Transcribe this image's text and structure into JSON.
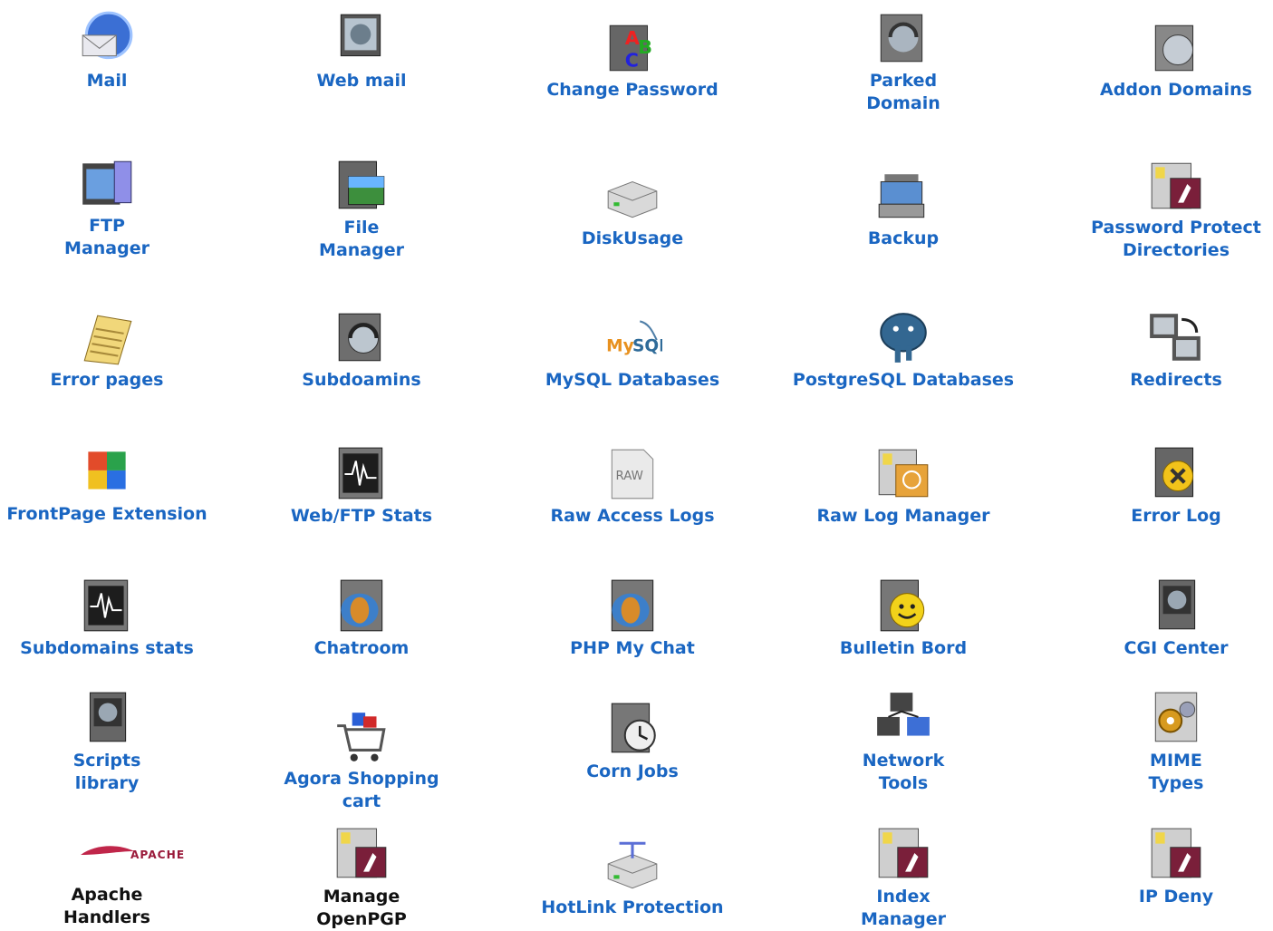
{
  "panel": {
    "items": [
      {
        "label": "Mail",
        "icon": "mail-icon",
        "link": true
      },
      {
        "label": "Web mail",
        "icon": "webmail-icon",
        "link": true
      },
      {
        "label": "Change Password",
        "icon": "change-password-icon",
        "link": true
      },
      {
        "label": "Parked\nDomain",
        "icon": "parked-domain-icon",
        "link": true
      },
      {
        "label": "Addon Domains",
        "icon": "addon-domains-icon",
        "link": true
      },
      {
        "label": "FTP\nManager",
        "icon": "ftp-manager-icon",
        "link": true
      },
      {
        "label": "File\nManager",
        "icon": "file-manager-icon",
        "link": true
      },
      {
        "label": "DiskUsage",
        "icon": "disk-usage-icon",
        "link": true
      },
      {
        "label": "Backup",
        "icon": "backup-icon",
        "link": true
      },
      {
        "label": "Password Protect\nDirectories",
        "icon": "password-protect-icon",
        "link": true
      },
      {
        "label": "Error pages",
        "icon": "error-pages-icon",
        "link": true
      },
      {
        "label": "Subdoamins",
        "icon": "subdomains-icon",
        "link": true
      },
      {
        "label": "MySQL Databases",
        "icon": "mysql-icon",
        "link": true
      },
      {
        "label": "PostgreSQL Databases",
        "icon": "postgresql-icon",
        "link": true
      },
      {
        "label": "Redirects",
        "icon": "redirects-icon",
        "link": true
      },
      {
        "label": "FrontPage Extension",
        "icon": "frontpage-icon",
        "link": true
      },
      {
        "label": "Web/FTP    Stats",
        "icon": "web-ftp-stats-icon",
        "link": true
      },
      {
        "label": "Raw Access Logs",
        "icon": "raw-access-logs-icon",
        "link": true
      },
      {
        "label": "Raw Log Manager",
        "icon": "raw-log-manager-icon",
        "link": true
      },
      {
        "label": "Error Log",
        "icon": "error-log-icon",
        "link": true
      },
      {
        "label": "Subdomains stats",
        "icon": "subdomains-stats-icon",
        "link": true
      },
      {
        "label": "Chatroom",
        "icon": "chatroom-icon",
        "link": true
      },
      {
        "label": "PHP My Chat",
        "icon": "php-my-chat-icon",
        "link": true
      },
      {
        "label": "Bulletin Bord",
        "icon": "bulletin-board-icon",
        "link": true
      },
      {
        "label": "CGI Center",
        "icon": "cgi-center-icon",
        "link": true
      },
      {
        "label": "Scripts\nlibrary",
        "icon": "scripts-library-icon",
        "link": true
      },
      {
        "label": "Agora Shopping\ncart",
        "icon": "shopping-cart-icon",
        "link": true
      },
      {
        "label": "Corn Jobs",
        "icon": "cron-jobs-icon",
        "link": true
      },
      {
        "label": "Network\nTools",
        "icon": "network-tools-icon",
        "link": true
      },
      {
        "label": "MIME\nTypes",
        "icon": "mime-types-icon",
        "link": true
      },
      {
        "label": "Apache\nHandlers",
        "icon": "apache-handlers-icon",
        "link": false
      },
      {
        "label": "Manage\nOpenPGP",
        "icon": "openpgp-icon",
        "link": false
      },
      {
        "label": "HotLink Protection",
        "icon": "hotlink-protection-icon",
        "link": true
      },
      {
        "label": "Index\nManager",
        "icon": "index-manager-icon",
        "link": true
      },
      {
        "label": "IP Deny",
        "icon": "ip-deny-icon",
        "link": true
      }
    ]
  },
  "colors": {
    "link": "#1a66c2",
    "plain": "#111111"
  }
}
